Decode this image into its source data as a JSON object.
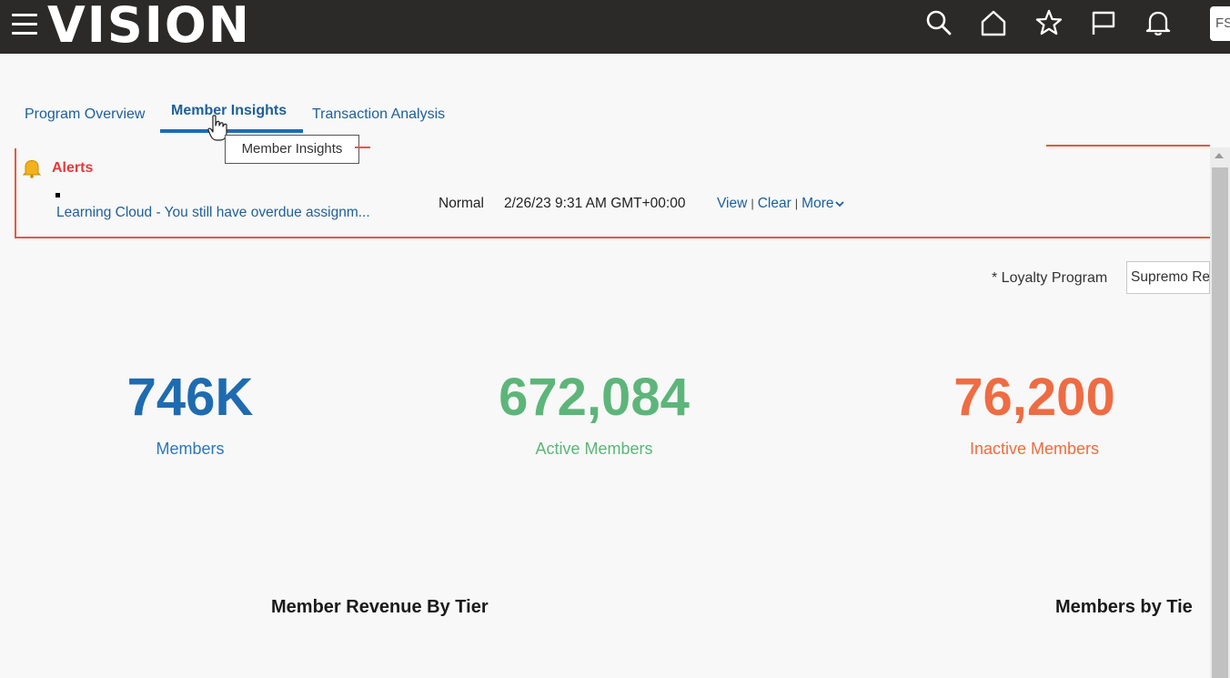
{
  "app": {
    "logo": "VISION",
    "user_initials": "FS"
  },
  "tabs": [
    {
      "label": "Program Overview"
    },
    {
      "label": "Member Insights"
    },
    {
      "label": "Transaction Analysis"
    }
  ],
  "tooltip": "Member Insights",
  "alerts": {
    "title": "Alerts",
    "message": "Learning Cloud - You still have overdue assignm...",
    "severity": "Normal",
    "timestamp": "2/26/23 9:31 AM GMT+00:00",
    "actions": {
      "view": "View",
      "clear": "Clear",
      "more": "More"
    }
  },
  "filter": {
    "label": "* Loyalty Program",
    "value": "Supremo Re"
  },
  "kpis": [
    {
      "value": "746K",
      "label": "Members",
      "color": "#1f6bb0"
    },
    {
      "value": "672,084",
      "label": "Active Members",
      "color": "#5db57a"
    },
    {
      "value": "76,200",
      "label": "Inactive Members",
      "color": "#ee6c43"
    }
  ],
  "sections": [
    {
      "title": "Member Revenue By Tier"
    },
    {
      "title": "Members by Tie"
    }
  ],
  "colors": {
    "topbar": "#2b2a29",
    "link": "#1f5f99",
    "alert": "#e4593f"
  }
}
